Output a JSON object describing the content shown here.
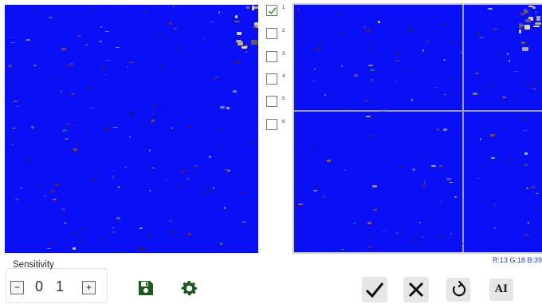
{
  "layers": [
    {
      "label": "1",
      "checked": true
    },
    {
      "label": "2",
      "checked": false
    },
    {
      "label": "3",
      "checked": false
    },
    {
      "label": "4",
      "checked": false
    },
    {
      "label": "5",
      "checked": false
    },
    {
      "label": "6",
      "checked": false
    }
  ],
  "pixel_readout": "R:13  G:18  B:39",
  "sensitivity": {
    "label": "Sensitivity",
    "digit_1": "0",
    "digit_2": "1",
    "decrease_label": "−",
    "increase_label": "+"
  },
  "toolbar": {
    "ai_label": "AI"
  },
  "colors": {
    "panel_blue": "#0a10f5",
    "grid_line": "#9a9aa8",
    "check_green": "#2e9a2e",
    "readout_blue": "#1f3fbf"
  },
  "icons": [
    "save-icon",
    "gear-icon",
    "check-icon",
    "close-icon",
    "rotate-icon",
    "ai-icon"
  ]
}
